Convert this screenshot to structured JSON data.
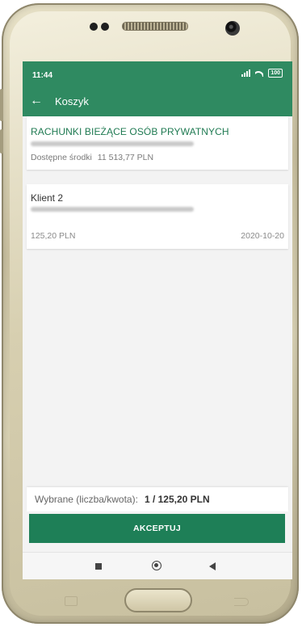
{
  "status_bar": {
    "time": "11:44",
    "battery": "100"
  },
  "app_bar": {
    "back_glyph": "←",
    "title": "Koszyk"
  },
  "account": {
    "title": "RACHUNKI BIEŻĄCE OSÓB PRYWATNYCH",
    "available_label": "Dostępne środki",
    "available_amount": "11 513,77 PLN"
  },
  "client": {
    "name": "Klient 2",
    "amount": "125,20 PLN",
    "date": "2020-10-20"
  },
  "summary": {
    "label": "Wybrane (liczba/kwota):",
    "value": "1 / 125,20 PLN"
  },
  "accept_button": {
    "label": "AKCEPTUJ"
  },
  "icons": {
    "back": "back-arrow-icon",
    "signal": "signal-icon",
    "wifi": "wifi-icon",
    "battery": "battery-icon",
    "nav_recent": "recent-apps-icon",
    "nav_home": "home-icon",
    "nav_back": "back-triangle-icon"
  },
  "colors": {
    "brand_green": "#2f8a61",
    "button_green": "#1e7f57",
    "account_title": "#1f7a52"
  }
}
